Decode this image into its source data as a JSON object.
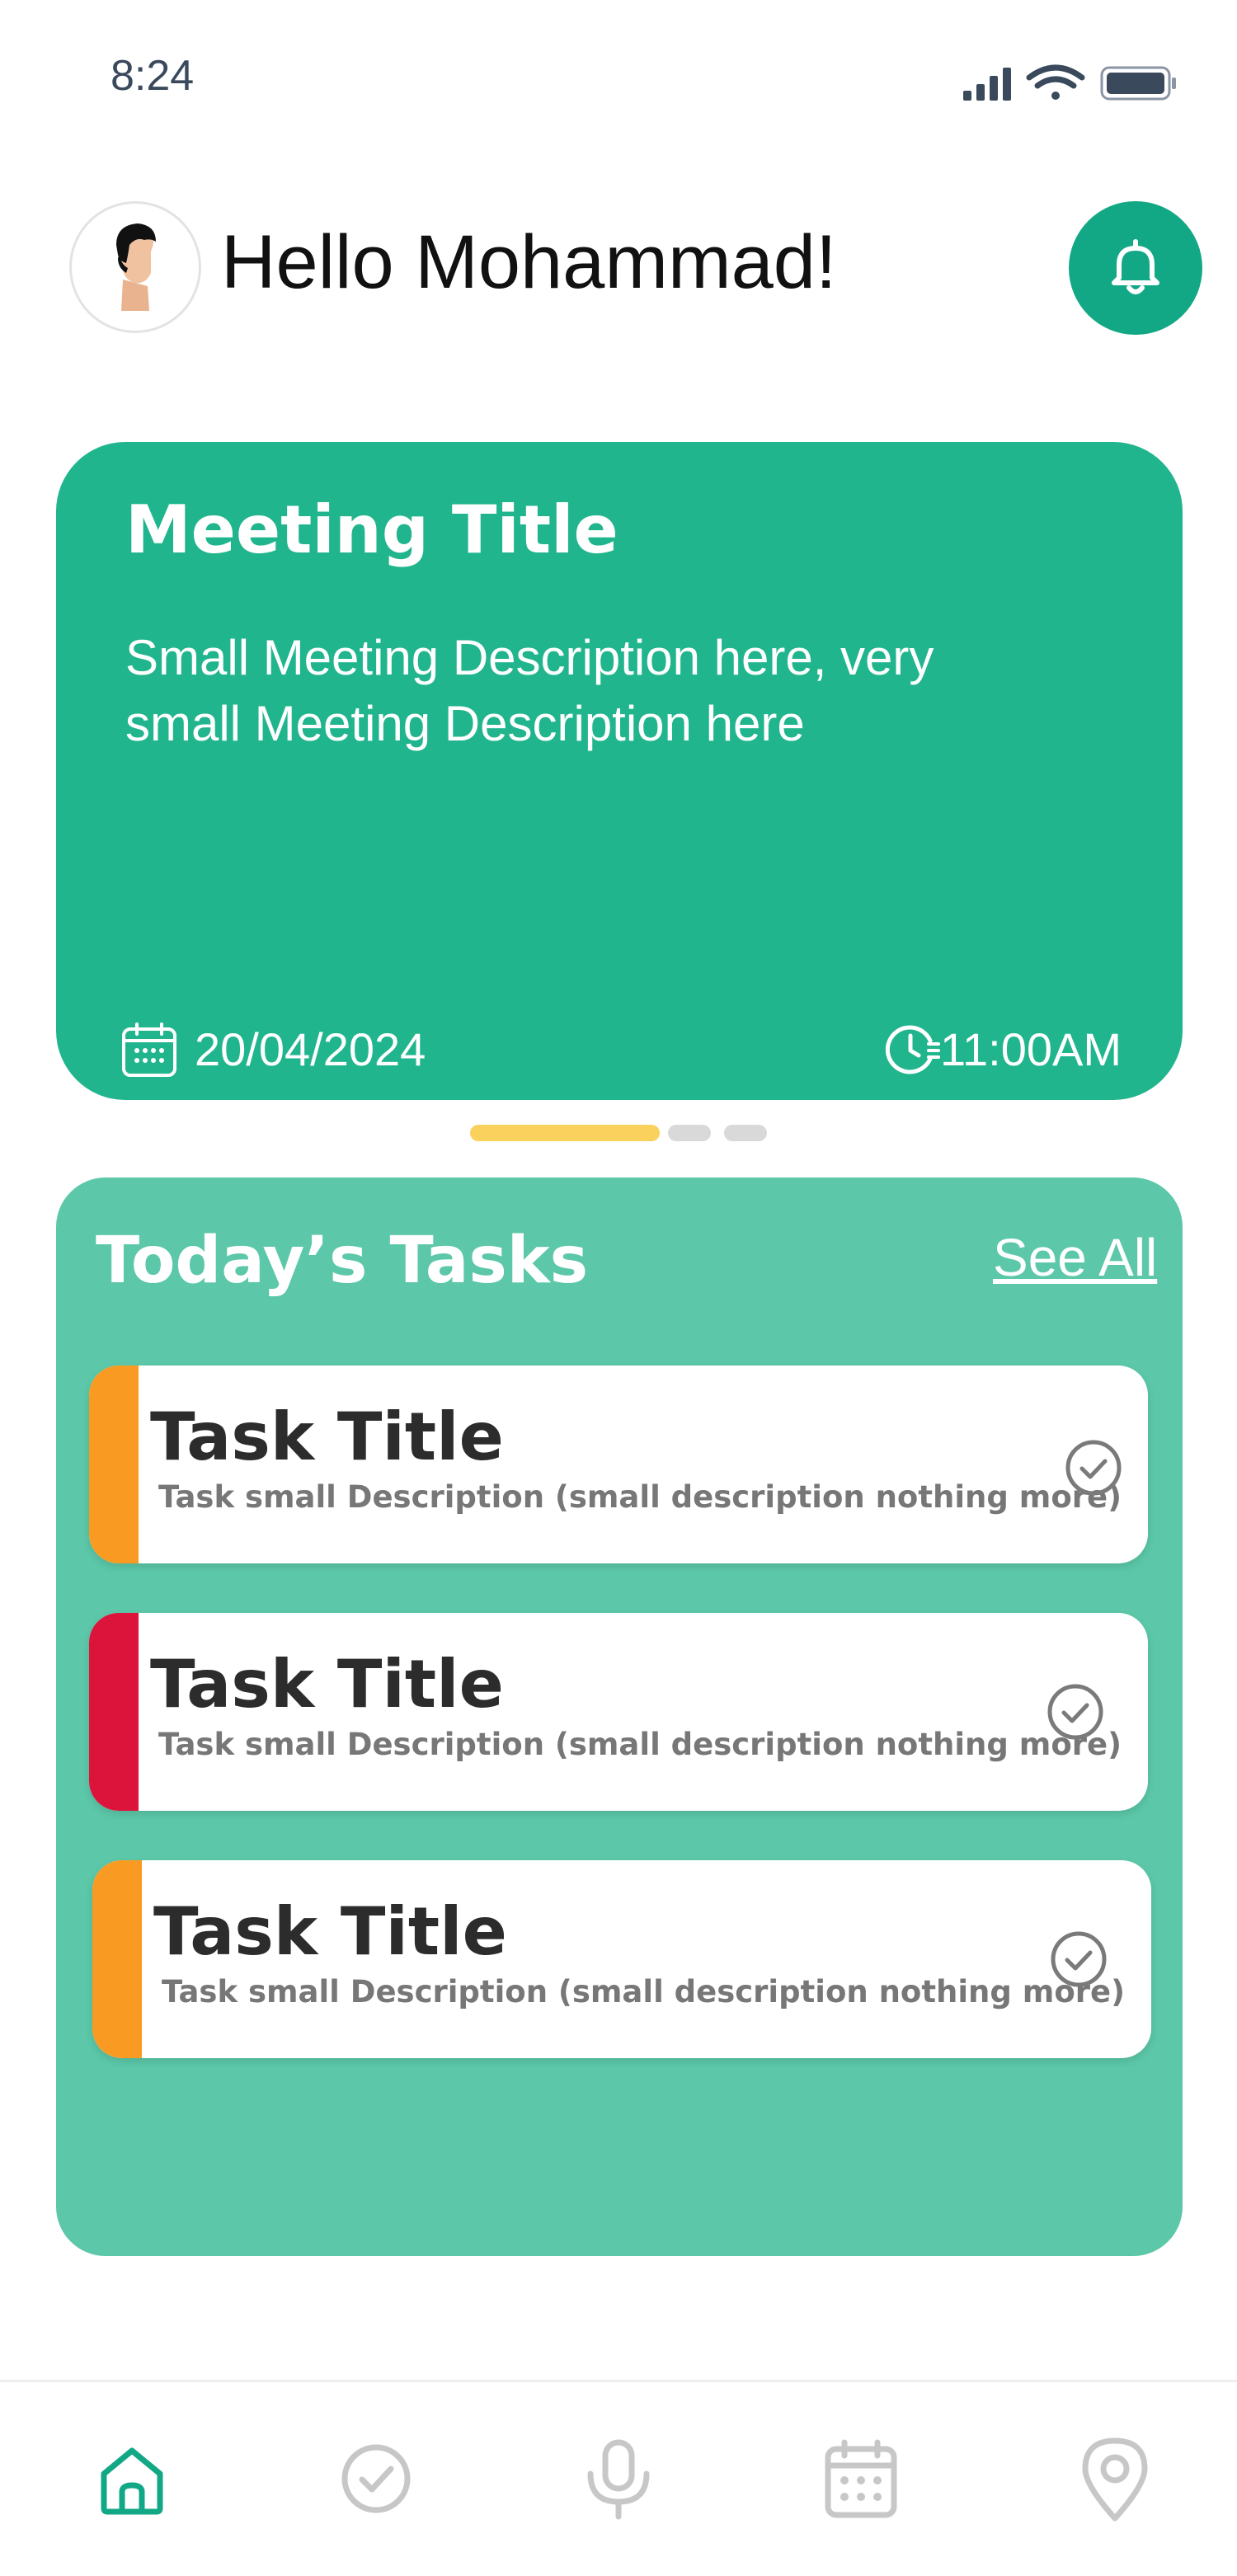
{
  "status_bar": {
    "time": "8:24",
    "icons": [
      "signal-icon",
      "wifi-icon",
      "battery-icon"
    ]
  },
  "header": {
    "greeting": "Hello Mohammad!",
    "avatar_icon": "user-avatar",
    "notification_icon": "bell-icon"
  },
  "meeting": {
    "title": "Meeting Title",
    "description": "Small Meeting Description here, very small Meeting Description here",
    "date": "20/04/2024",
    "time": "11:00AM",
    "date_icon": "calendar-icon",
    "time_icon": "clock-icon"
  },
  "carousel": {
    "active_index": 0,
    "count": 3
  },
  "tasks": {
    "heading": "Today’s Tasks",
    "see_all": "See All",
    "items": [
      {
        "title": "Task Title",
        "description": "Task small Description (small description nothing more)",
        "priority_color": "#f99b22"
      },
      {
        "title": "Task Title",
        "description": "Task small Description (small description nothing more)",
        "priority_color": "#dc143c"
      },
      {
        "title": "Task Title",
        "description": "Task small Description (small description nothing more)",
        "priority_color": "#f99b22"
      }
    ]
  },
  "bottom_nav": {
    "active": "home",
    "items": [
      {
        "id": "home",
        "icon": "home-icon"
      },
      {
        "id": "tasks",
        "icon": "check-circle-icon"
      },
      {
        "id": "voice",
        "icon": "microphone-icon"
      },
      {
        "id": "calendar",
        "icon": "calendar-icon"
      },
      {
        "id": "location",
        "icon": "location-pin-icon"
      }
    ]
  },
  "colors": {
    "accent": "#12a886",
    "meeting_card": "#21b58e",
    "tasks_panel": "#5cc8a9",
    "carousel_active": "#f9d15c",
    "nav_inactive": "#c7c7c7"
  }
}
